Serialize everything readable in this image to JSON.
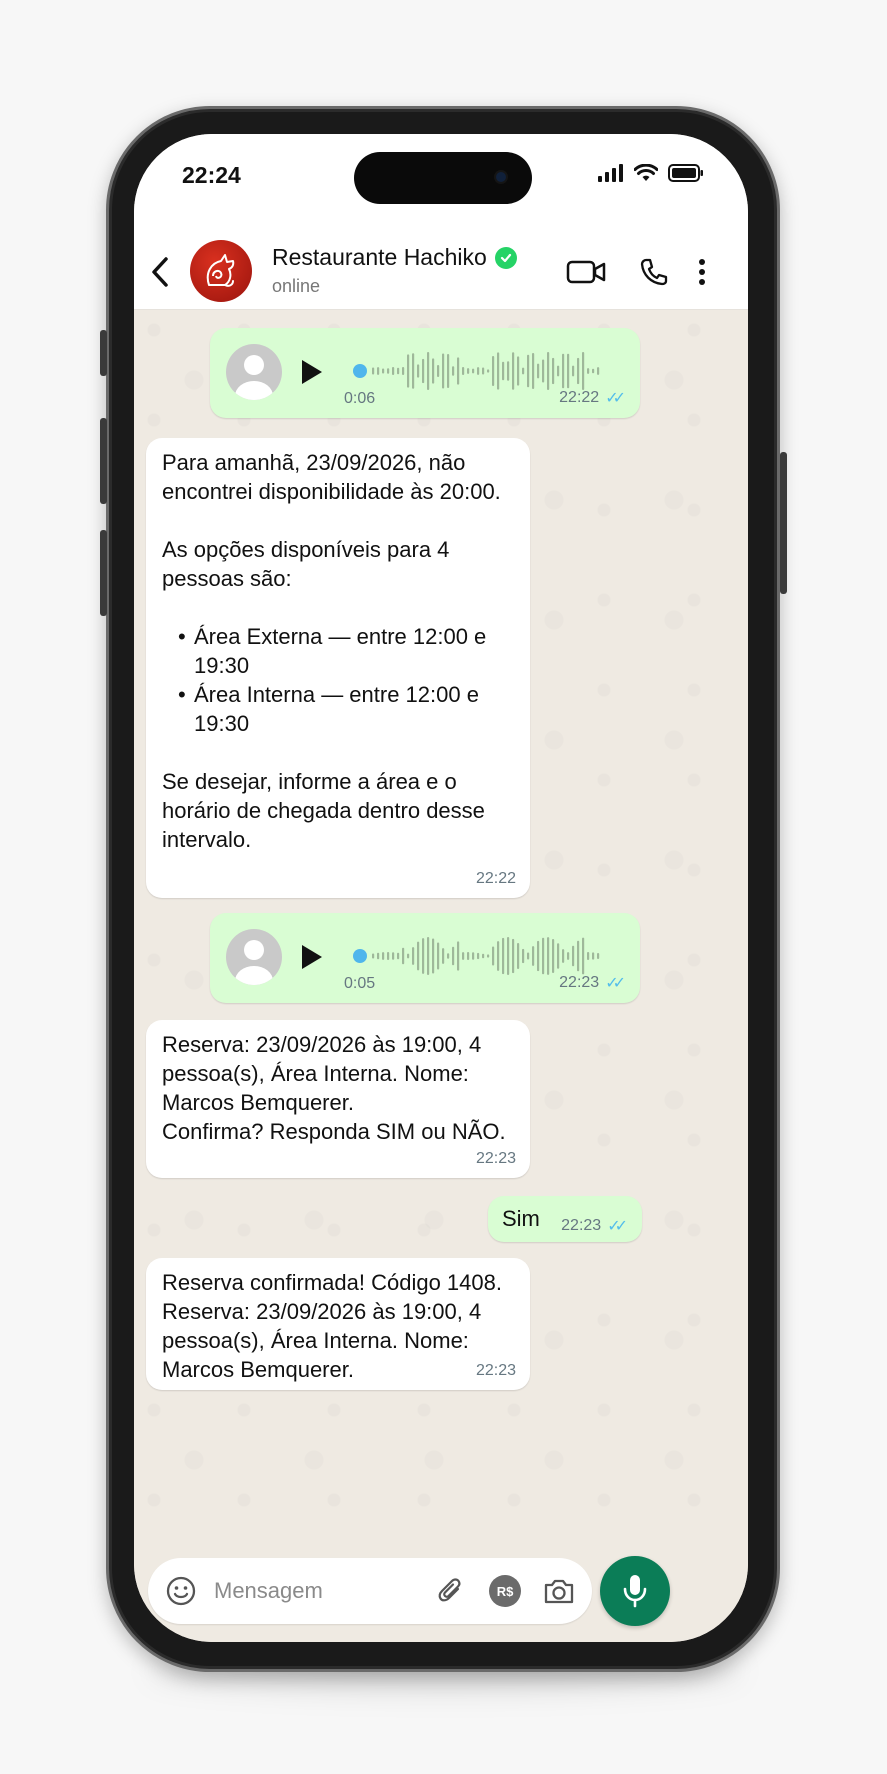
{
  "status_bar": {
    "time": "22:24"
  },
  "header": {
    "contact_name": "Restaurante Hachiko",
    "contact_status": "online"
  },
  "messages": [
    {
      "type": "voice",
      "direction": "outgoing",
      "duration": "0:06",
      "time": "22:22",
      "read": true
    },
    {
      "type": "text",
      "direction": "incoming",
      "paragraph1": "Para amanhã, 23/09/2026, não encontrei disponibilidade às 20:00.",
      "paragraph2": "As opções disponíveis para 4 pessoas são:",
      "bullets": [
        "Área Externa — entre 12:00 e 19:30",
        "Área Interna — entre 12:00 e 19:30"
      ],
      "paragraph3": "Se desejar, informe a área e o horário de chegada dentro desse intervalo.",
      "time": "22:22"
    },
    {
      "type": "voice",
      "direction": "outgoing",
      "duration": "0:05",
      "time": "22:23",
      "read": true
    },
    {
      "type": "text",
      "direction": "incoming",
      "text": "Reserva: 23/09/2026 às 19:00, 4 pessoa(s), Área Interna. Nome: Marcos Bemquerer.\nConfirma? Responda SIM ou NÃO.",
      "time": "22:23"
    },
    {
      "type": "text",
      "direction": "outgoing",
      "text": "Sim",
      "time": "22:23",
      "read": true
    },
    {
      "type": "text",
      "direction": "incoming",
      "text": "Reserva confirmada! Código 1408. Reserva: 23/09/2026 às 19:00, 4 pessoa(s), Área Interna. Nome: Marcos Bemquerer.",
      "time": "22:23"
    }
  ],
  "composer": {
    "placeholder": "Mensagem",
    "currency_icon_label": "R$"
  },
  "colors": {
    "outgoing_bubble": "#d9fdd3",
    "incoming_bubble": "#ffffff",
    "chat_background": "#efeae2",
    "read_ticks": "#53bdeb",
    "mic_button": "#0b7d57",
    "verified_badge": "#25d366"
  },
  "icons": [
    "back-arrow-icon",
    "verified-icon",
    "video-call-icon",
    "phone-icon",
    "more-vert-icon",
    "play-icon",
    "emoji-icon",
    "attach-icon",
    "payment-icon",
    "camera-icon",
    "mic-icon",
    "signal-icon",
    "wifi-icon",
    "battery-icon"
  ]
}
